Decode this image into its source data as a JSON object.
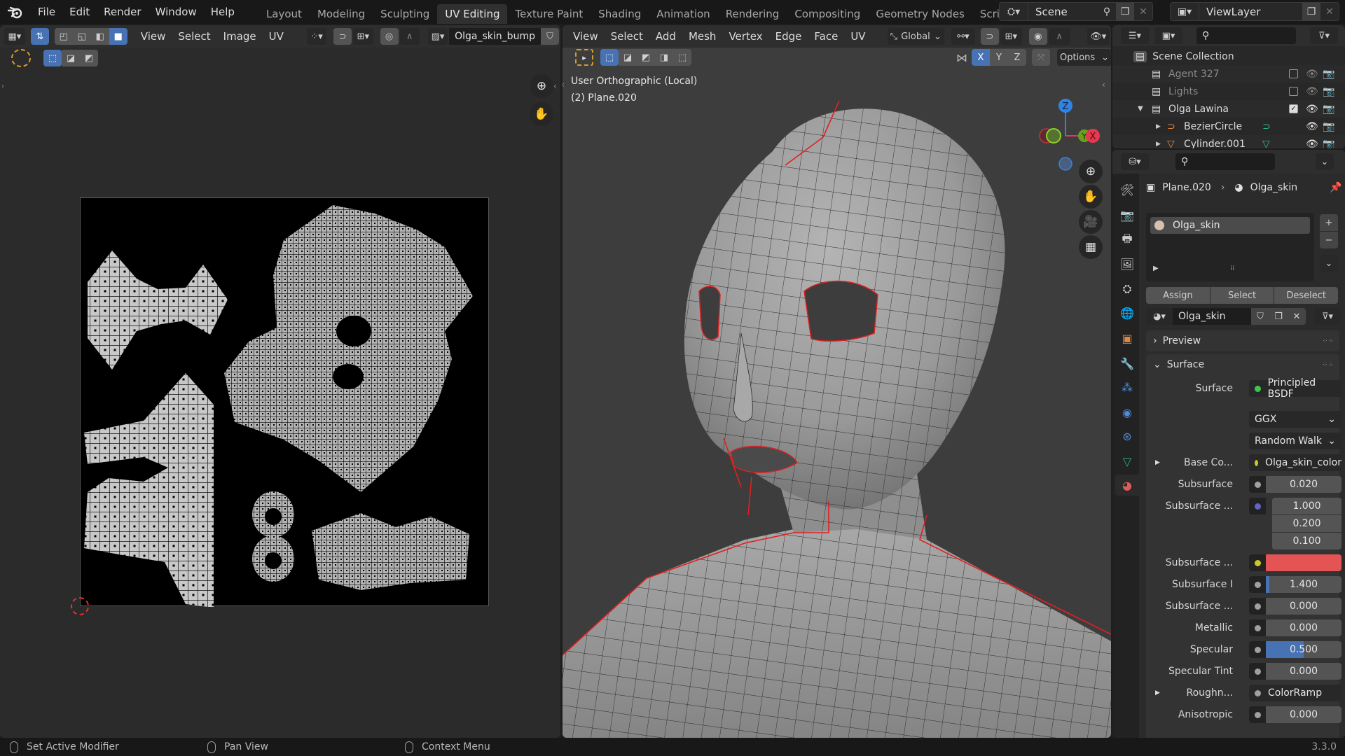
{
  "app": {
    "version": "3.3.0"
  },
  "topbar": {
    "menus": [
      "File",
      "Edit",
      "Render",
      "Window",
      "Help"
    ],
    "workspaces": [
      "Layout",
      "Modeling",
      "Sculpting",
      "UV Editing",
      "Texture Paint",
      "Shading",
      "Animation",
      "Rendering",
      "Compositing",
      "Geometry Nodes",
      "Scripting"
    ],
    "active_workspace": "UV Editing",
    "add_tab": "+",
    "scene": "Scene",
    "view_layer": "ViewLayer"
  },
  "uv_editor": {
    "menus": [
      "View",
      "Select",
      "Image",
      "UV"
    ],
    "image_name": "Olga_skin_bump",
    "uv_select_modes": [
      "vertex",
      "edge",
      "face",
      "island"
    ],
    "active_select_mode": "island"
  },
  "viewport": {
    "menus": [
      "View",
      "Select",
      "Add",
      "Mesh",
      "Vertex",
      "Edge",
      "Face",
      "UV"
    ],
    "transform_orientation": "Global",
    "mirror_axes": [
      "X",
      "Y",
      "Z"
    ],
    "mirror_active": "X",
    "options_label": "Options",
    "view_name": "User Orthographic (Local)",
    "object_info": "(2) Plane.020",
    "gizmo_axes": {
      "z": "Z",
      "y": "Y",
      "x": "X"
    },
    "colors": {
      "seam": "#e02020",
      "x_axis": "#e8384f",
      "y_axis": "#6c9e1e",
      "z_axis": "#2f84e3"
    }
  },
  "outliner": {
    "root": "Scene Collection",
    "items": [
      {
        "name": "Agent 327",
        "type": "collection",
        "excluded": true,
        "checked": false
      },
      {
        "name": "Lights",
        "type": "collection",
        "excluded": true,
        "checked": false
      },
      {
        "name": "Olga Lawina",
        "type": "collection",
        "expanded": true,
        "checked": true
      },
      {
        "name": "BezierCircle",
        "type": "curve",
        "indent": 1
      },
      {
        "name": "Cylinder.001",
        "type": "mesh",
        "indent": 1
      }
    ]
  },
  "properties": {
    "breadcrumb": {
      "object": "Plane.020",
      "material": "Olga_skin"
    },
    "material_slots": [
      "Olga_skin"
    ],
    "slot_buttons": [
      "Assign",
      "Select",
      "Deselect"
    ],
    "material_name": "Olga_skin",
    "panels": {
      "preview": "Preview",
      "surface": "Surface"
    },
    "surface": {
      "surface_label": "Surface",
      "surface_shader": "Principled BSDF",
      "distribution": "GGX",
      "subsurface_method": "Random Walk",
      "rows": [
        {
          "label": "Base Co...",
          "type": "link",
          "value": "Olga_skin_color",
          "socket_color": "#c7c729",
          "expandable": true
        },
        {
          "label": "Subsurface",
          "type": "number",
          "value": "0.020",
          "fraction": 0
        },
        {
          "label": "Subsurface ...",
          "type": "vector",
          "values": [
            "1.000",
            "0.200",
            "0.100"
          ],
          "socket_color": "#6363c7"
        },
        {
          "label": "Subsurface ...",
          "type": "color",
          "color": "#e55454",
          "socket_color": "#c7c729"
        },
        {
          "label": "Subsurface I",
          "type": "number",
          "value": "1.400",
          "fraction": 0.05
        },
        {
          "label": "Subsurface ...",
          "type": "number",
          "value": "0.000",
          "fraction": 0
        },
        {
          "label": "Metallic",
          "type": "number",
          "value": "0.000",
          "fraction": 0
        },
        {
          "label": "Specular",
          "type": "number",
          "value": "0.500",
          "fraction": 0.5
        },
        {
          "label": "Specular Tint",
          "type": "number",
          "value": "0.000",
          "fraction": 0
        },
        {
          "label": "Roughn...",
          "type": "link",
          "value": "ColorRamp",
          "socket_color": "#a0a0a0",
          "expandable": true
        },
        {
          "label": "Anisotropic",
          "type": "number",
          "value": "0.000",
          "fraction": 0
        }
      ]
    }
  },
  "statusbar": {
    "left": "Set Active Modifier",
    "middle": "Pan View",
    "right": "Context Menu",
    "version": "3.3.0"
  }
}
